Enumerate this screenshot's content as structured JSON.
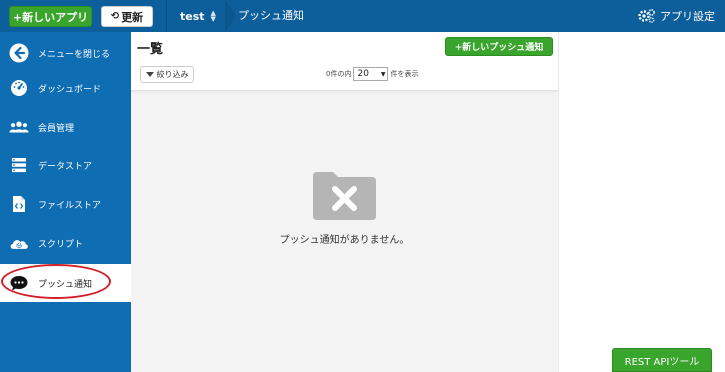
{
  "header": {
    "new_app_label": "+新しいアプリ",
    "refresh_label": "更新",
    "app_name": "test",
    "page_crumb": "プッシュ通知",
    "settings_label": "アプリ設定"
  },
  "sidebar": {
    "items": [
      {
        "label": "メニューを閉じる",
        "icon": "arrow-left-icon"
      },
      {
        "label": "ダッシュボード",
        "icon": "dashboard-gauge-icon"
      },
      {
        "label": "会員管理",
        "icon": "users-icon"
      },
      {
        "label": "データストア",
        "icon": "datastore-icon"
      },
      {
        "label": "ファイルストア",
        "icon": "file-icon"
      },
      {
        "label": "スクリプト",
        "icon": "cloud-gear-icon"
      },
      {
        "label": "プッシュ通知",
        "icon": "chat-bubble-icon",
        "active": true
      }
    ]
  },
  "main": {
    "title": "一覧",
    "new_push_label": "+新しいプッシュ通知",
    "filter_label": "絞り込み",
    "count_prefix": "0件の内",
    "per_page": "20",
    "count_suffix": "件を表示",
    "empty_message": "プッシュ通知がありません。"
  },
  "footer": {
    "rest_tool_label": "REST APIツール"
  },
  "colors": {
    "topbar": "#0d5f9c",
    "sidebar": "#0f6db3",
    "green": "#3aa52c",
    "highlight": "#d0202a"
  }
}
